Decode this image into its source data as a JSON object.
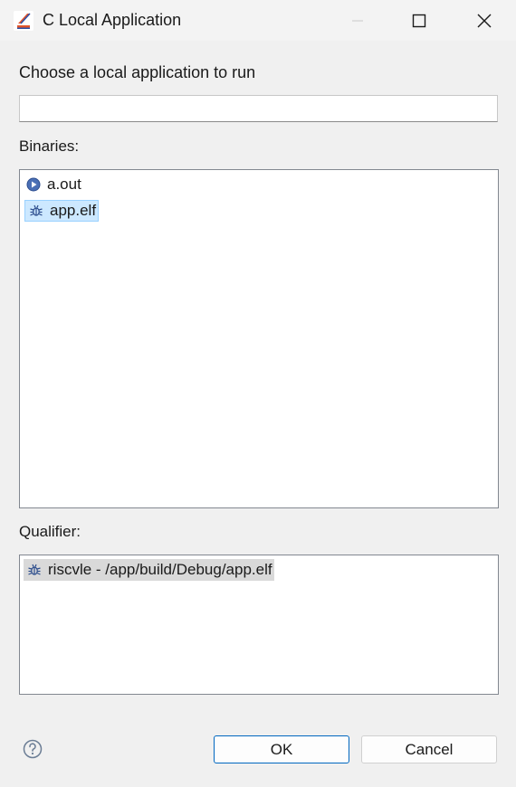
{
  "window": {
    "title": "C Local Application",
    "minimize_icon": "minimize-icon",
    "maximize_icon": "maximize-icon",
    "close_icon": "close-icon"
  },
  "prompt": "Choose a local application to run",
  "filter": {
    "value": "",
    "placeholder": ""
  },
  "binaries": {
    "label": "Binaries:",
    "items": [
      {
        "label": "a.out",
        "icon": "run-icon",
        "selected": false
      },
      {
        "label": "app.elf",
        "icon": "debug-bug-icon",
        "selected": true
      }
    ]
  },
  "qualifier": {
    "label": "Qualifier:",
    "items": [
      {
        "label": "riscvle - /app/build/Debug/app.elf",
        "icon": "debug-bug-icon",
        "selected": true
      }
    ]
  },
  "buttons": {
    "help_icon": "help-icon",
    "ok": "OK",
    "cancel": "Cancel"
  },
  "colors": {
    "selection": "#cce8ff",
    "selection_border": "#99d1ff",
    "inactive_selection": "#d9d9d9",
    "default_button_border": "#0067c0"
  }
}
